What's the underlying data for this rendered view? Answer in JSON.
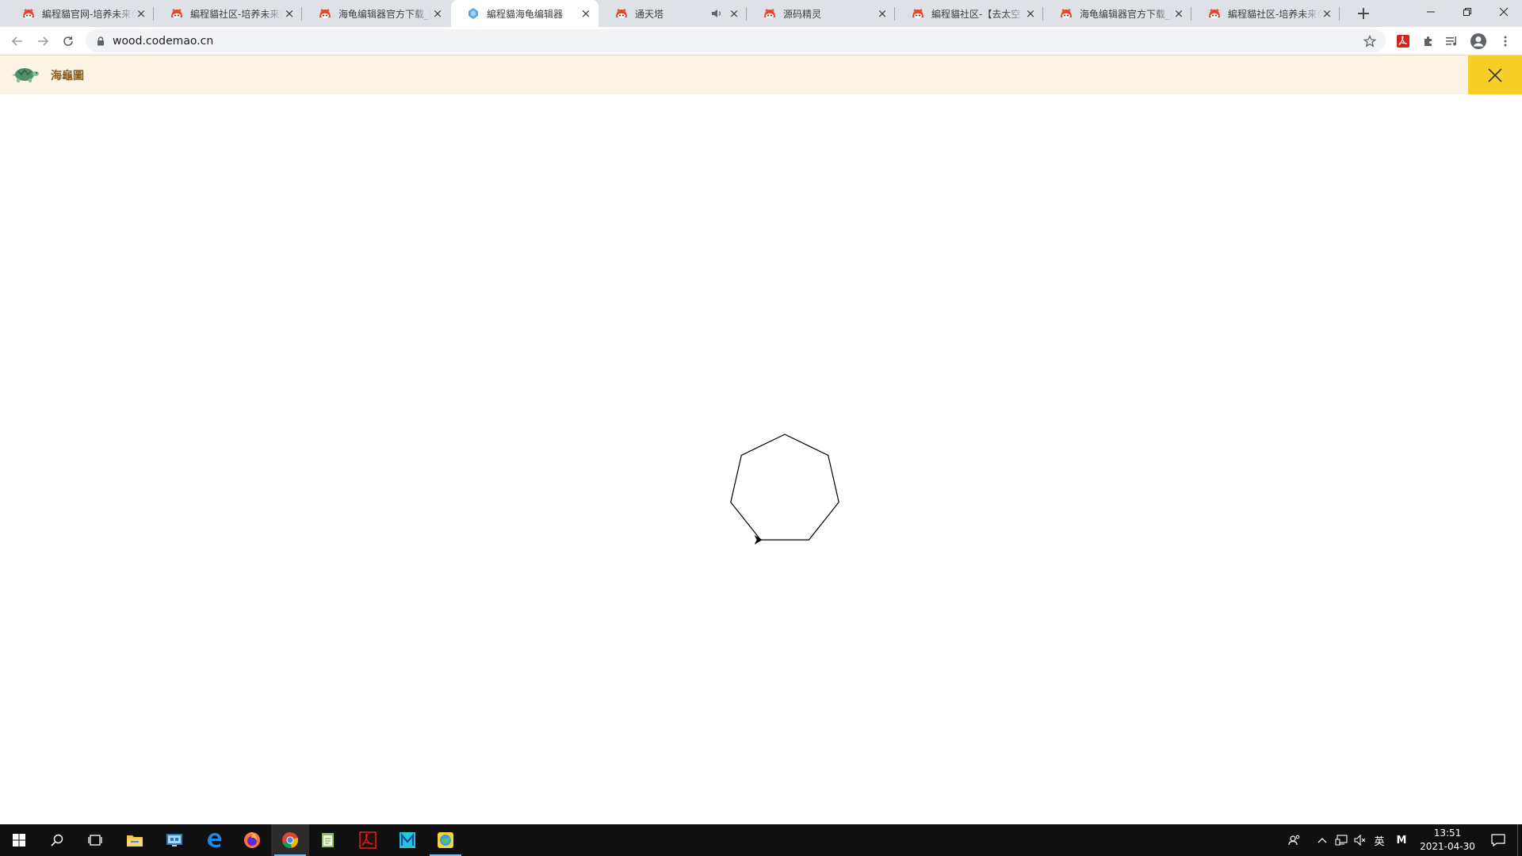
{
  "browser": {
    "tabs": [
      {
        "title": "編程貓官网-培养未来创",
        "icon": "codemao-favicon",
        "active": false
      },
      {
        "title": "編程貓社区-培养未来创",
        "icon": "codemao-favicon",
        "active": false
      },
      {
        "title": "海龟编辑器官方下载_P",
        "icon": "codemao-favicon",
        "active": false
      },
      {
        "title": "編程貓海龟编辑器",
        "icon": "turtle-editor-favicon",
        "active": true
      },
      {
        "title": "通天塔",
        "icon": "codemao-favicon",
        "active": false,
        "audio": true
      },
      {
        "title": "源码精灵",
        "icon": "codemao-favicon",
        "active": false
      },
      {
        "title": "編程貓社区-【去太空",
        "icon": "codemao-favicon",
        "active": false
      },
      {
        "title": "海龟编辑器官方下载_P",
        "icon": "codemao-favicon",
        "active": false
      },
      {
        "title": "編程貓社区-培养未来创",
        "icon": "codemao-favicon",
        "active": false
      }
    ],
    "close_glyph": "×",
    "new_tab_glyph": "+",
    "url": "wood.codemao.cn"
  },
  "banner": {
    "title": "海龜圖",
    "logo": "turtle-logo-icon",
    "close_icon": "close-icon",
    "close_bg": "#f8cf26",
    "bg": "#fbf3e3"
  },
  "drawing": {
    "shape": "heptagon",
    "sides": 7,
    "turtle": "arrow-cursor"
  },
  "taskbar": {
    "clock_time": "13:51",
    "clock_date": "2021-04-30",
    "ime_label": "英",
    "ime_mode": "M"
  }
}
